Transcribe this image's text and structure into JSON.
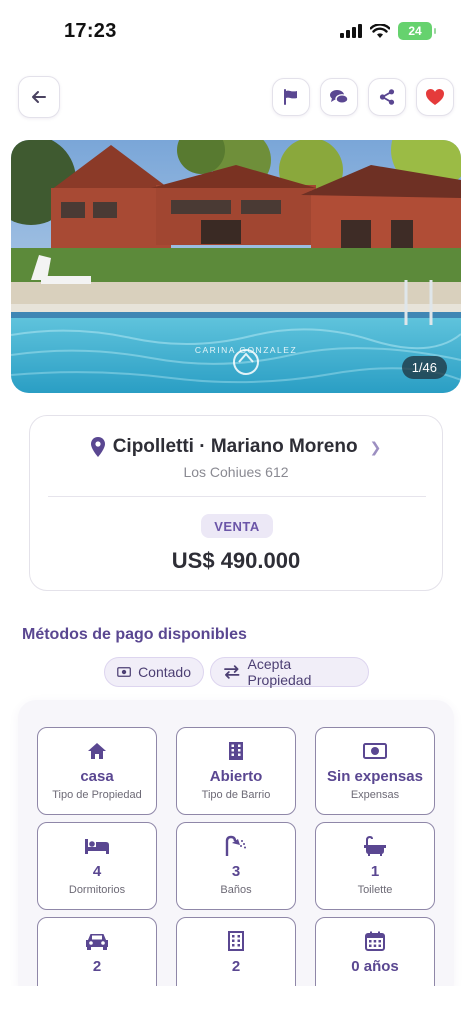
{
  "status": {
    "time": "17:23",
    "battery": "24"
  },
  "toolbar": {
    "back_icon": "arrow-left-icon",
    "flag_icon": "flag-icon",
    "chat_icon": "chat-icon",
    "share_icon": "share-icon",
    "favorite_icon": "heart-icon"
  },
  "photo": {
    "counter": "1/46",
    "watermark": "CARINA GONZALEZ"
  },
  "location": {
    "title": "Cipolletti · Mariano Moreno",
    "address": "Los Cohiues 612",
    "operation": "VENTA",
    "price": "US$ 490.000"
  },
  "payment": {
    "title": "Métodos de pago disponibles",
    "methods": [
      {
        "label": "Contado",
        "icon": "cash-icon"
      },
      {
        "label": "Acepta Propiedad",
        "icon": "swap-icon"
      }
    ]
  },
  "features": [
    {
      "value": "casa",
      "label": "Tipo de Propiedad",
      "icon": "house-icon"
    },
    {
      "value": "Abierto",
      "label": "Tipo de Barrio",
      "icon": "building-icon"
    },
    {
      "value": "Sin expensas",
      "label": "Expensas",
      "icon": "cash-icon"
    },
    {
      "value": "4",
      "label": "Dormitorios",
      "icon": "bed-icon"
    },
    {
      "value": "3",
      "label": "Baños",
      "icon": "shower-icon"
    },
    {
      "value": "1",
      "label": "Toilette",
      "icon": "bathtub-icon"
    },
    {
      "value": "2",
      "label": "",
      "icon": "car-icon"
    },
    {
      "value": "2",
      "label": "",
      "icon": "building-icon"
    },
    {
      "value": "0 años",
      "label": "",
      "icon": "calendar-icon"
    }
  ],
  "colors": {
    "accent": "#5a4791",
    "favorite": "#e53b3b",
    "chip_bg": "#f1eef8"
  }
}
